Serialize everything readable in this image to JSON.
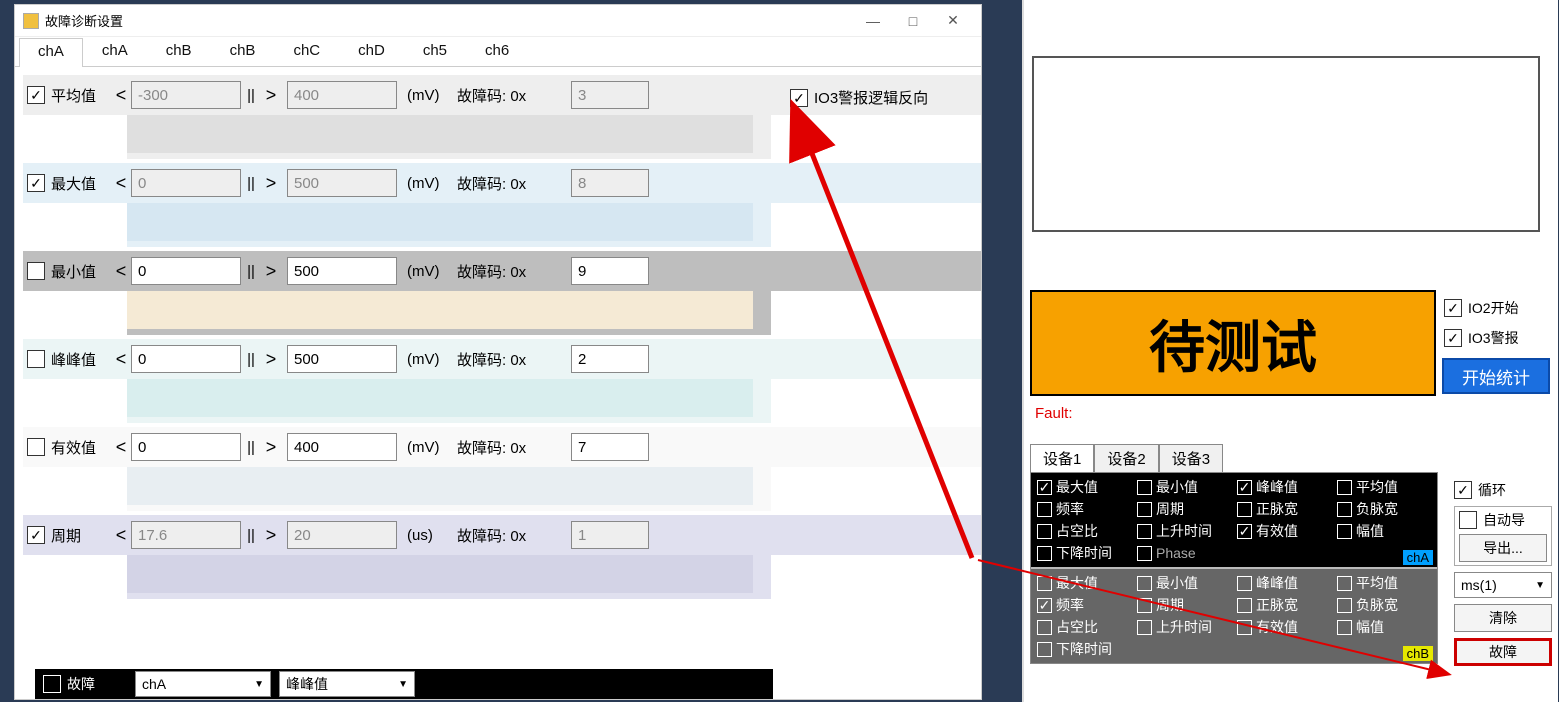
{
  "dialog": {
    "title": "故障诊断设置",
    "tabs": [
      "chA",
      "chA",
      "chB",
      "chB",
      "chC",
      "chD",
      "ch5",
      "ch6"
    ],
    "rows": [
      {
        "key": "avg",
        "label": "平均值",
        "checked": true,
        "lo": "-300",
        "hi": "400",
        "unit": "(mV)",
        "code": "3",
        "readonly": true
      },
      {
        "key": "max",
        "label": "最大值",
        "checked": true,
        "lo": "0",
        "hi": "500",
        "unit": "(mV)",
        "code": "8",
        "readonly": true
      },
      {
        "key": "min",
        "label": "最小值",
        "checked": false,
        "lo": "0",
        "hi": "500",
        "unit": "(mV)",
        "code": "9",
        "readonly": false
      },
      {
        "key": "pp",
        "label": "峰峰值",
        "checked": false,
        "lo": "0",
        "hi": "500",
        "unit": "(mV)",
        "code": "2",
        "readonly": false
      },
      {
        "key": "rms",
        "label": "有效值",
        "checked": false,
        "lo": "0",
        "hi": "400",
        "unit": "(mV)",
        "code": "7",
        "readonly": false
      },
      {
        "key": "per",
        "label": "周期",
        "checked": true,
        "lo": "17.6",
        "hi": "20",
        "unit": "(us)",
        "code": "1",
        "readonly": true
      }
    ],
    "fault_prefix": "故障码:  0x",
    "lt": "<",
    "gt": ">",
    "bar": "||",
    "io3_reverse": {
      "checked": true,
      "label": "IO3警报逻辑反向"
    },
    "bottom": {
      "fault": "故障",
      "combo1": "chA",
      "combo2": "峰峰值"
    }
  },
  "right": {
    "status": "待测试",
    "io2": {
      "checked": true,
      "label": "IO2开始"
    },
    "io3": {
      "checked": true,
      "label": "IO3警报"
    },
    "start_stat": "开始统计",
    "fault_label": "Fault:",
    "dev_tabs": [
      "设备1",
      "设备2",
      "设备3"
    ],
    "blockA": {
      "items": [
        {
          "t": "最大值",
          "c": true
        },
        {
          "t": "最小值",
          "c": false
        },
        {
          "t": "峰峰值",
          "c": true
        },
        {
          "t": "平均值",
          "c": false
        },
        {
          "t": "频率",
          "c": false
        },
        {
          "t": "周期",
          "c": false
        },
        {
          "t": "正脉宽",
          "c": false
        },
        {
          "t": "负脉宽",
          "c": false
        },
        {
          "t": "占空比",
          "c": false
        },
        {
          "t": "上升时间",
          "c": false
        },
        {
          "t": "有效值",
          "c": true
        },
        {
          "t": "幅值",
          "c": false
        },
        {
          "t": "下降时间",
          "c": false
        },
        {
          "t": "Phase",
          "c": false,
          "dim": true
        }
      ],
      "badge": "chA"
    },
    "blockB": {
      "items": [
        {
          "t": "最大值",
          "c": false
        },
        {
          "t": "最小值",
          "c": false
        },
        {
          "t": "峰峰值",
          "c": false
        },
        {
          "t": "平均值",
          "c": false
        },
        {
          "t": "频率",
          "c": true
        },
        {
          "t": "周期",
          "c": false
        },
        {
          "t": "正脉宽",
          "c": false
        },
        {
          "t": "负脉宽",
          "c": false
        },
        {
          "t": "占空比",
          "c": false
        },
        {
          "t": "上升时间",
          "c": false
        },
        {
          "t": "有效值",
          "c": false
        },
        {
          "t": "幅值",
          "c": false
        },
        {
          "t": "下降时间",
          "c": false
        }
      ],
      "badge": "chB"
    },
    "side": {
      "loop": {
        "checked": true,
        "label": "循环"
      },
      "auto_export": {
        "checked": false,
        "label": "自动导"
      },
      "export_btn": "导出...",
      "unit_sel": "ms(1)",
      "clear_btn": "清除",
      "fault_btn": "故障"
    }
  }
}
